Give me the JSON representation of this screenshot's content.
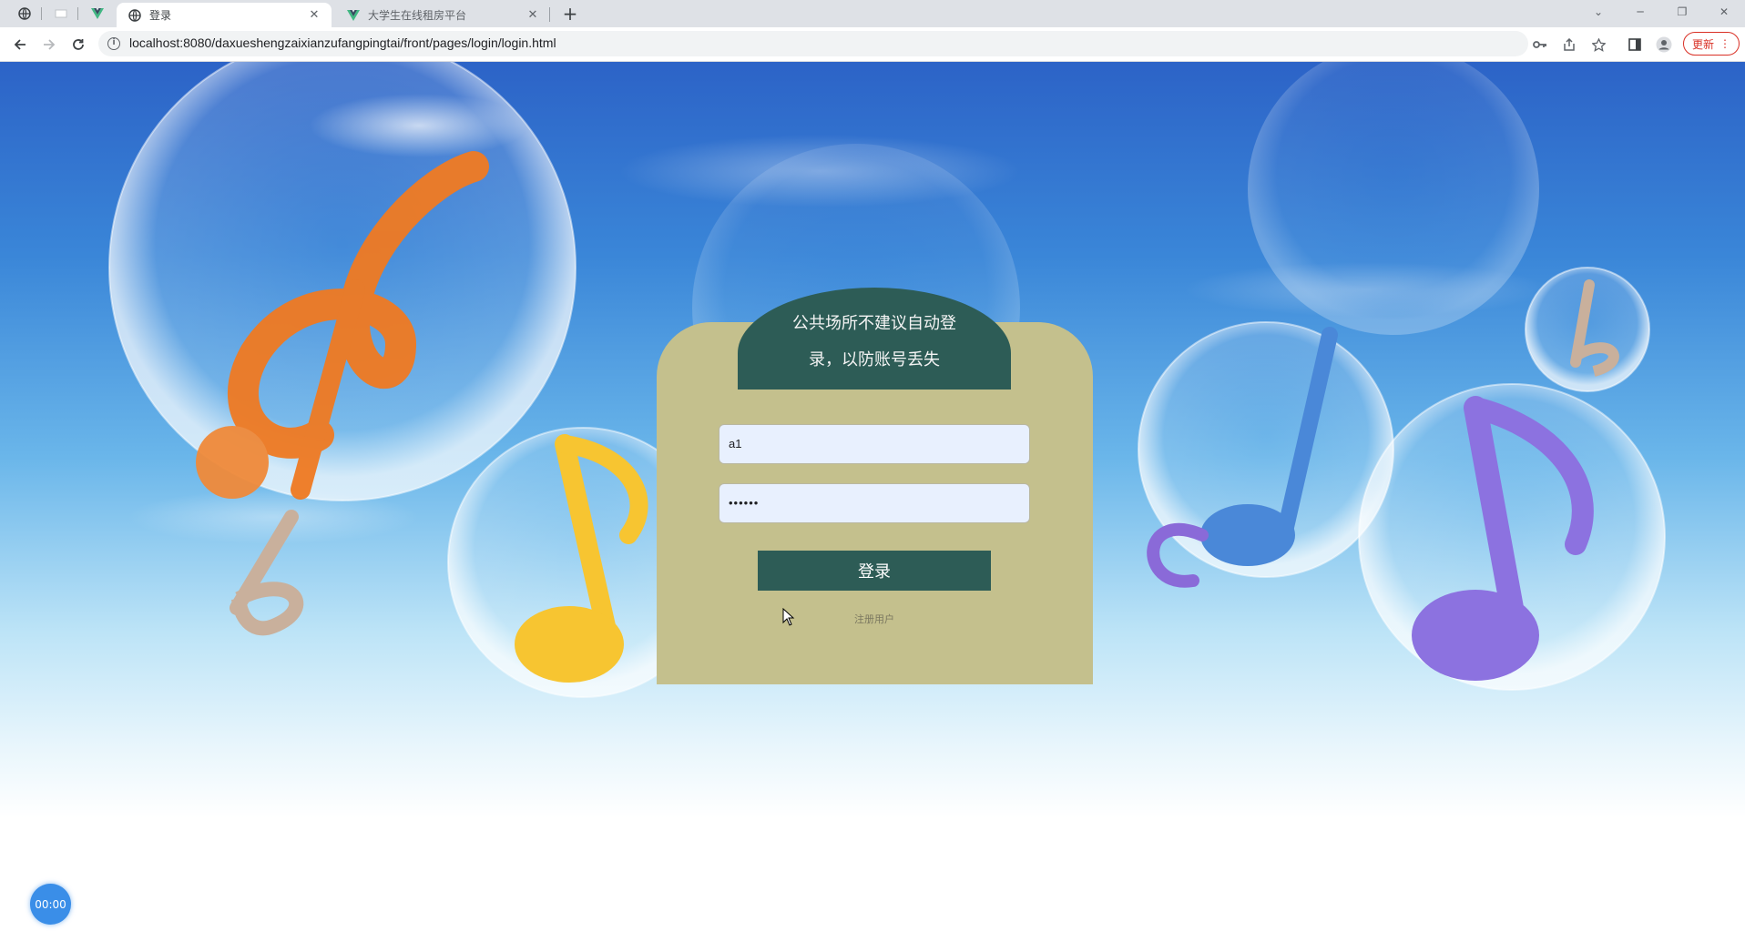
{
  "browser": {
    "tabs": [
      {
        "title": "登录",
        "icon": "globe-icon",
        "active": true
      },
      {
        "title": "大学生在线租房平台",
        "icon": "vue-icon",
        "active": false
      }
    ],
    "url": "localhost:8080/daxueshengzaixianzufangpingtai/front/pages/login/login.html",
    "update_label": "更新"
  },
  "login": {
    "notice_line1": "公共场所不建议自动登",
    "notice_line2": "录，以防账号丢失",
    "username_value": "a1",
    "password_value": "••••••",
    "login_button": "登录",
    "register_link": "注册用户"
  },
  "overlay": {
    "timer": "00:00"
  },
  "colors": {
    "card_bg": "#c4c08d",
    "accent_green": "#2d5c56",
    "sky_top": "#2c63c7"
  }
}
